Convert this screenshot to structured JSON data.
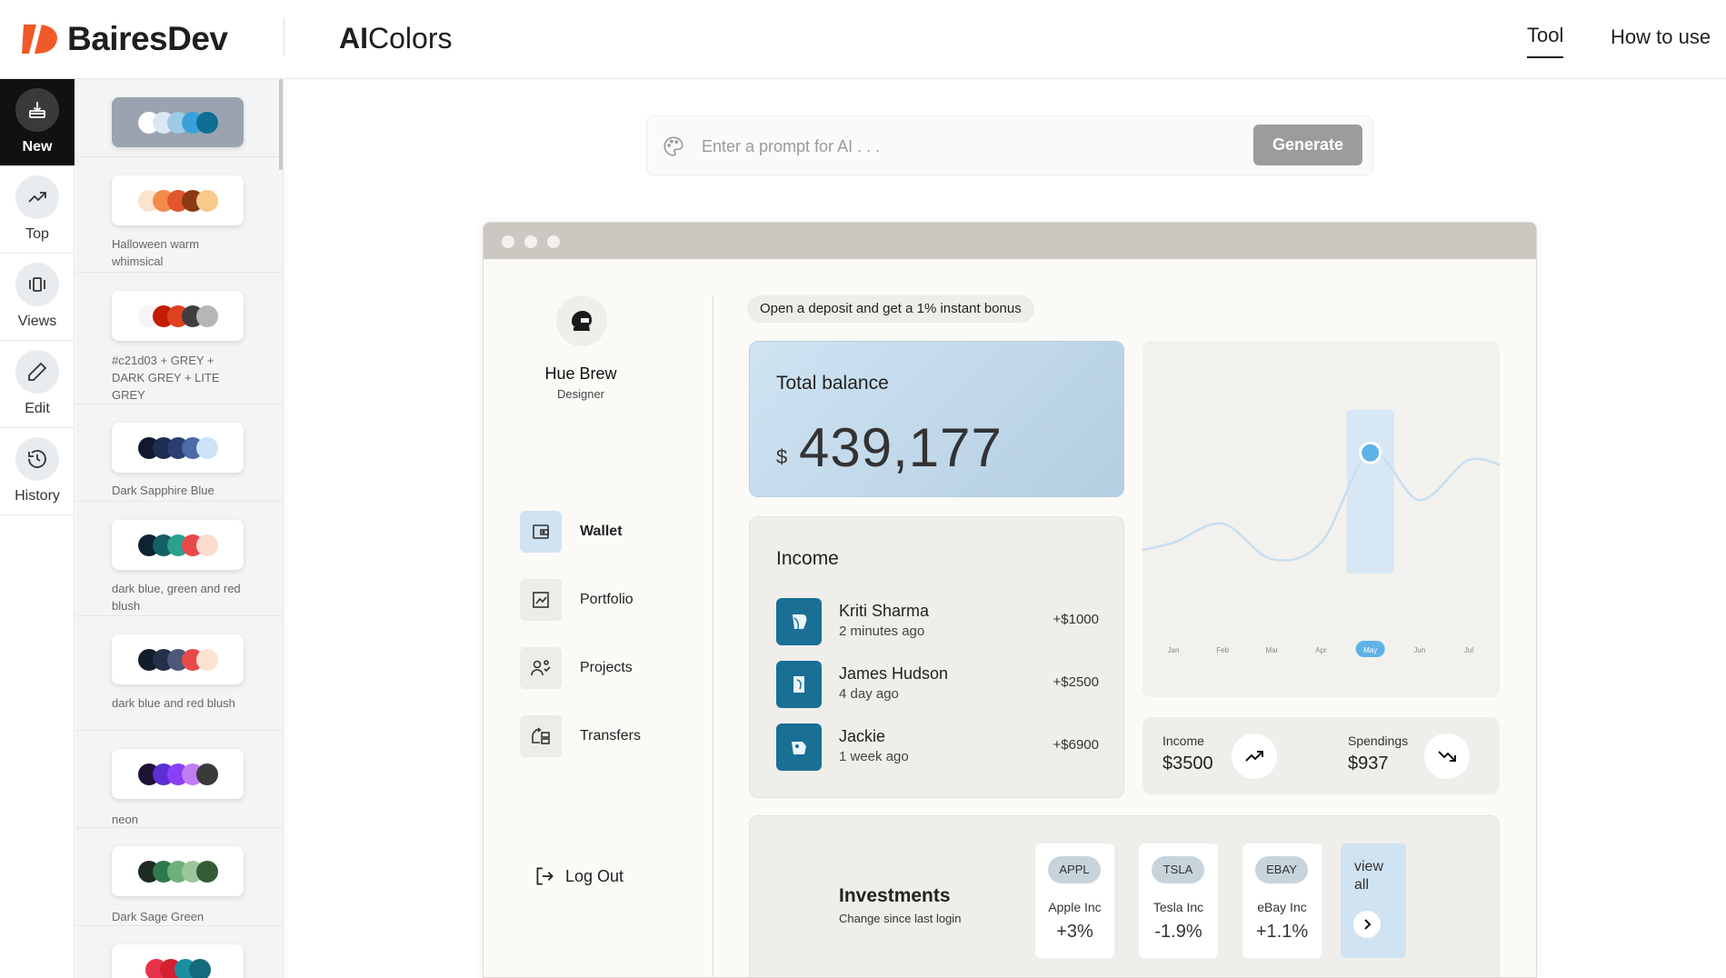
{
  "header": {
    "brand": "BairesDev",
    "app_title_bold": "AI",
    "app_title_rest": "Colors",
    "nav_tool": "Tool",
    "nav_how": "How to use"
  },
  "rail": {
    "items": [
      {
        "label": "New",
        "icon": "new-icon"
      },
      {
        "label": "Top",
        "icon": "trending-up-icon"
      },
      {
        "label": "Views",
        "icon": "views-icon"
      },
      {
        "label": "Edit",
        "icon": "pencil-icon"
      },
      {
        "label": "History",
        "icon": "history-icon"
      }
    ]
  },
  "palettes": [
    {
      "name": "",
      "colors": [
        "#ffffff",
        "#dbe8f4",
        "#9ecbe4",
        "#3aa0dc",
        "#0d6e96"
      ]
    },
    {
      "name": "Halloween warm whimsical",
      "colors": [
        "#fbe4cd",
        "#f28a4a",
        "#e2562c",
        "#8c3a14",
        "#f7c98a"
      ]
    },
    {
      "name": "#c21d03 + GREY + DARK GREY + LITE GREY",
      "colors": [
        "#f5f5f5",
        "#c21d03",
        "#e0411e",
        "#3e3e3e",
        "#b6b6b6"
      ]
    },
    {
      "name": "Dark Sapphire Blue",
      "colors": [
        "#0f1a30",
        "#1c2c52",
        "#2b3f6e",
        "#4c6aa6",
        "#cde3f7"
      ]
    },
    {
      "name": "dark blue, green and red blush",
      "colors": [
        "#0d2233",
        "#136066",
        "#2aa08e",
        "#e84848",
        "#fbdccf"
      ]
    },
    {
      "name": "dark blue and red blush",
      "colors": [
        "#141c2c",
        "#24304a",
        "#4c5878",
        "#e84a4a",
        "#fbe3d3"
      ]
    },
    {
      "name": "neon",
      "colors": [
        "#1f1235",
        "#5b2fd4",
        "#8a3ff5",
        "#c07df2",
        "#3a3a3a"
      ]
    },
    {
      "name": "Dark Sage Green",
      "colors": [
        "#1f2a22",
        "#2e7a4c",
        "#6fb07a",
        "#9cc79c",
        "#335c36"
      ]
    },
    {
      "name": "",
      "colors": [
        "#e8324a",
        "#d41f2f",
        "#1a8fa0",
        "#146a7c"
      ]
    }
  ],
  "prompt": {
    "placeholder": "Enter a prompt for AI . . .",
    "button": "Generate"
  },
  "preview": {
    "user": {
      "name": "Hue Brew",
      "role": "Designer"
    },
    "nav": [
      {
        "label": "Wallet",
        "icon": "wallet-icon",
        "active": true
      },
      {
        "label": "Portfolio",
        "icon": "portfolio-icon",
        "active": false
      },
      {
        "label": "Projects",
        "icon": "projects-icon",
        "active": false
      },
      {
        "label": "Transfers",
        "icon": "transfers-icon",
        "active": false
      }
    ],
    "logout": "Log Out",
    "promo": "Open a deposit and get a 1% instant bonus",
    "balance": {
      "title": "Total balance",
      "currency": "$",
      "value": "439,177"
    },
    "income": {
      "title": "Income",
      "rows": [
        {
          "name": "Kriti Sharma",
          "time": "2 minutes ago",
          "amount": "+$1000"
        },
        {
          "name": "James Hudson",
          "time": "4 day ago",
          "amount": "+$2500"
        },
        {
          "name": "Jackie",
          "time": "1 week ago",
          "amount": "+$6900"
        }
      ]
    },
    "stats": {
      "income_label": "Income",
      "income_value": "$3500",
      "spend_label": "Spendings",
      "spend_value": "$937"
    },
    "investments": {
      "title": "Investments",
      "subtitle": "Change since last login",
      "stocks": [
        {
          "ticker": "APPL",
          "name": "Apple Inc",
          "change": "+3%"
        },
        {
          "ticker": "TSLA",
          "name": "Tesla Inc",
          "change": "-1.9%"
        },
        {
          "ticker": "EBAY",
          "name": "eBay Inc",
          "change": "+1.1%"
        }
      ],
      "view_all": "view all"
    }
  },
  "chart_data": {
    "type": "line",
    "categories": [
      "Jan",
      "Feb",
      "Mar",
      "Apr",
      "May",
      "Jun",
      "Jul"
    ],
    "values": [
      30,
      38,
      23,
      30,
      68,
      48,
      65
    ],
    "highlight": "May",
    "ylim": [
      0,
      100
    ],
    "line_color": "#c9def0",
    "highlight_color": "#5fb2e6"
  },
  "colors": {
    "accent": "#5fb2e6",
    "brand": "#f05a28"
  }
}
